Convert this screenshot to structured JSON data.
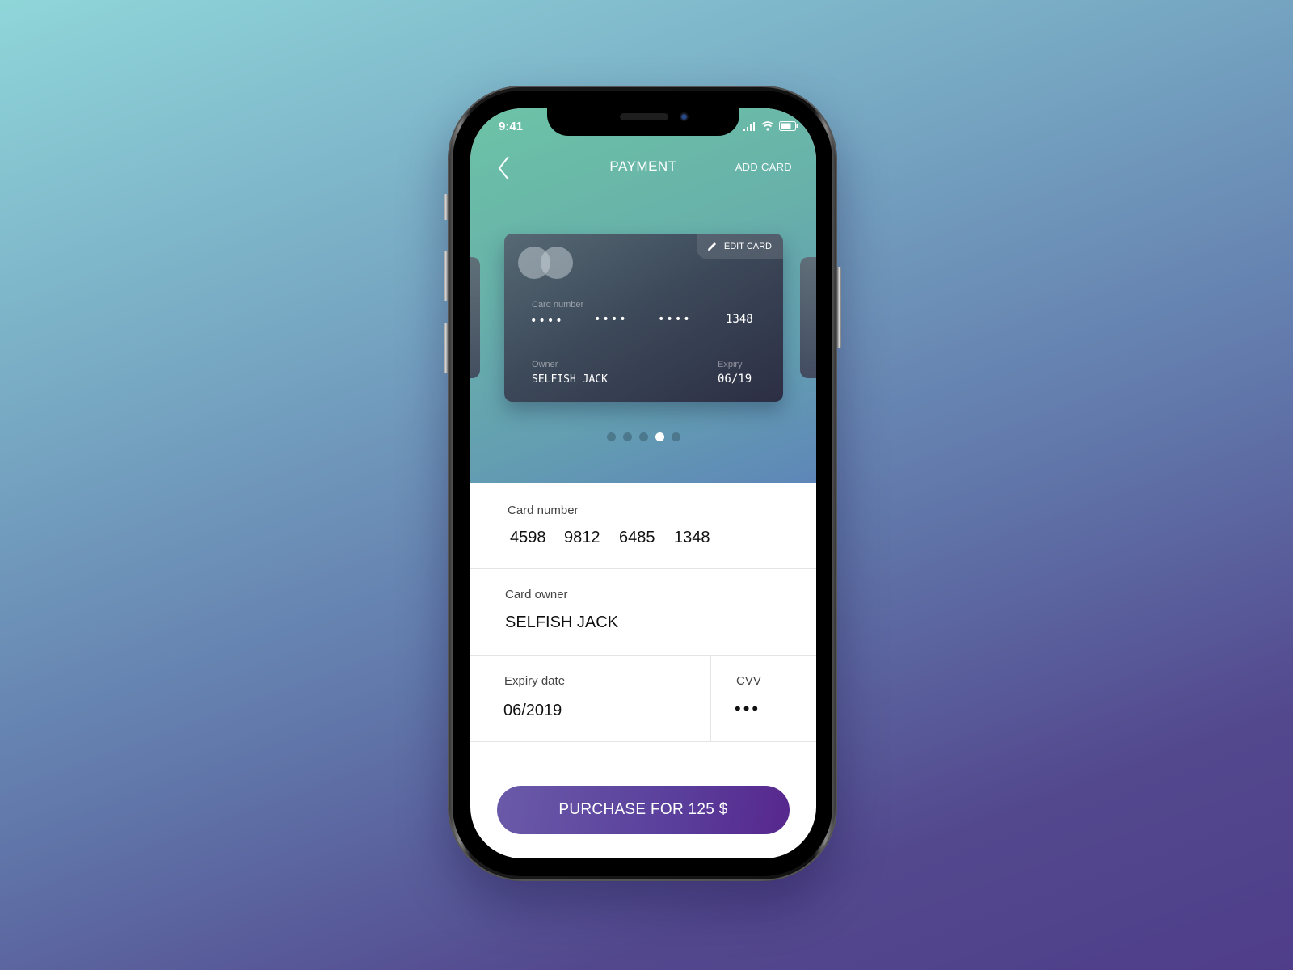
{
  "status_bar": {
    "time": "9:41",
    "icons": [
      "signal-icon",
      "wifi-icon",
      "battery-icon"
    ]
  },
  "nav": {
    "back_icon": "chevron-left-icon",
    "title": "PAYMENT",
    "add_card": "ADD CARD"
  },
  "card": {
    "edit_label": "EDIT CARD",
    "edit_icon": "pencil-icon",
    "brand_icon": "mastercard-logo-icon",
    "number_label": "Card number",
    "masked_groups": [
      "••••",
      "••••",
      "••••"
    ],
    "last4": "1348",
    "owner_label": "Owner",
    "owner": "SELFISH JACK",
    "expiry_label": "Expiry",
    "expiry": "06/19"
  },
  "carousel": {
    "count": 5,
    "active_index": 3
  },
  "form": {
    "card_number_label": "Card number",
    "card_number_groups": [
      "4598",
      "9812",
      "6485",
      "1348"
    ],
    "owner_label": "Card owner",
    "owner_value": "SELFISH JACK",
    "expiry_label": "Expiry date",
    "expiry_value": "06/2019",
    "cvv_label": "CVV",
    "cvv_value": "•••"
  },
  "purchase_button": "PURCHASE FOR 125 $",
  "colors": {
    "button_start": "#6a5aa8",
    "button_end": "#57278d",
    "hero_start": "#6cc3a6",
    "hero_end": "#5e86b8"
  }
}
